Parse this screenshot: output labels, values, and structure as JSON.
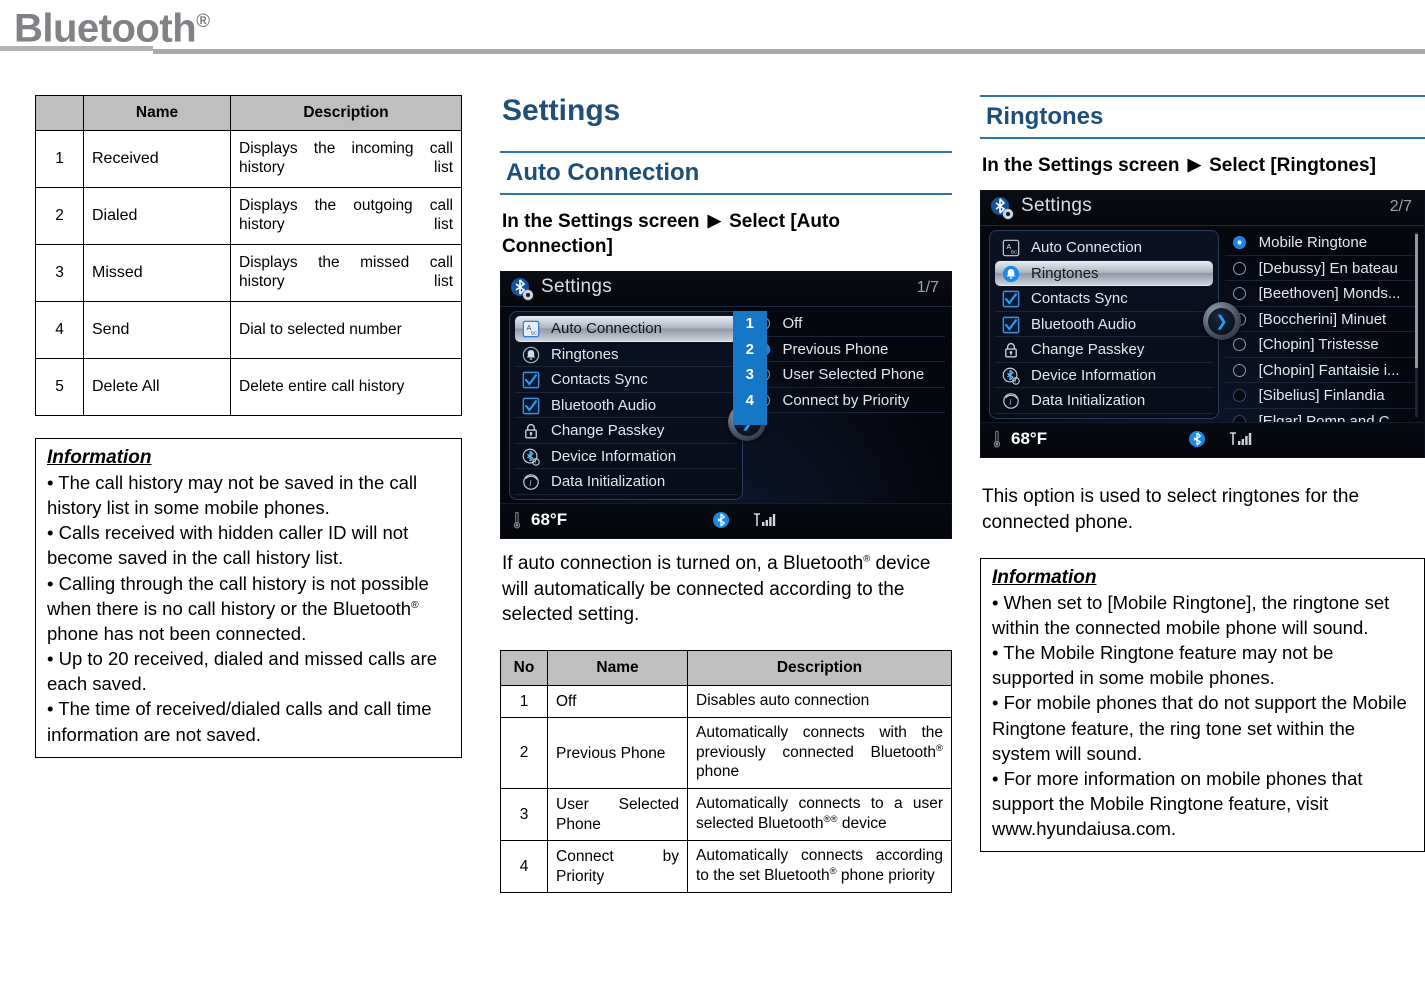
{
  "header": {
    "title": "Bluetooth",
    "registered_mark": "®"
  },
  "left_column": {
    "table": {
      "headers": [
        "",
        "Name",
        "Description"
      ],
      "rows": [
        {
          "no": "1",
          "name": "Received",
          "desc": "Displays the incoming call history list"
        },
        {
          "no": "2",
          "name": "Dialed",
          "desc": "Displays the outgoing call history list"
        },
        {
          "no": "3",
          "name": "Missed",
          "desc": "Displays the missed call history list"
        },
        {
          "no": "4",
          "name": "Send",
          "desc": "Dial to selected number"
        },
        {
          "no": "5",
          "name": "Delete All",
          "desc": "Delete entire call history"
        }
      ]
    },
    "information": {
      "title": "Information",
      "items": [
        "• The call history may not be saved in the call history list in some mobile phones.",
        "• Calls received with hidden caller ID will not become saved in the call history list.",
        "• Calling through the call history is not possible when there is no call history or the Bluetooth® phone has not been connected.",
        "• Up to 20 received, dialed and missed calls are each saved.",
        "• The time of received/dialed calls and call time information are not saved."
      ]
    }
  },
  "middle_column": {
    "chapter_title": "Settings",
    "section_title": "Auto Connection",
    "step_text_before": "In the Settings screen",
    "step_arrow": "▶",
    "step_text_after": "Select [Auto Connection]",
    "screenshot": {
      "title": "Settings",
      "page_indicator": "1/7",
      "menu_items": [
        {
          "label": "Auto Connection",
          "icon": "abc-icon",
          "selected": true,
          "checkbox": false
        },
        {
          "label": "Ringtones",
          "icon": "bell-icon",
          "selected": false,
          "checkbox": false
        },
        {
          "label": "Contacts Sync",
          "icon": "checkbox-icon",
          "selected": false,
          "checkbox": true
        },
        {
          "label": "Bluetooth Audio",
          "icon": "checkbox-icon",
          "selected": false,
          "checkbox": true
        },
        {
          "label": "Change Passkey",
          "icon": "lock-icon",
          "selected": false,
          "checkbox": false
        },
        {
          "label": "Device Information",
          "icon": "bluetooth-info-icon",
          "selected": false,
          "checkbox": false
        },
        {
          "label": "Data Initialization",
          "icon": "info-icon",
          "selected": false,
          "checkbox": false
        }
      ],
      "options": [
        {
          "label": "Off",
          "selected": false,
          "callout": "1"
        },
        {
          "label": "Previous Phone",
          "selected": true,
          "callout": "2"
        },
        {
          "label": "User Selected Phone",
          "selected": false,
          "callout": "3"
        },
        {
          "label": "Connect by Priority",
          "selected": false,
          "callout": "4"
        }
      ],
      "status_bar": {
        "temperature": "68°F"
      }
    },
    "body_text": "If auto connection is turned on, a Bluetooth® device will automatically be connected according to the selected setting.",
    "table": {
      "headers": [
        "No",
        "Name",
        "Description"
      ],
      "rows": [
        {
          "no": "1",
          "name": "Off",
          "desc": "Disables auto connection",
          "justify": false
        },
        {
          "no": "2",
          "name": "Previous Phone",
          "desc": "Automatically connects with the previously connected Bluetooth® phone",
          "justify": true
        },
        {
          "no": "3",
          "name": "User Selected Phone",
          "desc": "Automatically connects to a user selected Bluetooth®® device",
          "justify": true
        },
        {
          "no": "4",
          "name": "Connect by Priority",
          "desc": "Automatically connects according to the set Bluetooth® phone priority",
          "justify": true
        }
      ]
    }
  },
  "right_column": {
    "section_title": "Ringtones",
    "step_text_before": "In the Settings screen",
    "step_arrow": "▶",
    "step_text_after": "Select [Ringtones]",
    "screenshot": {
      "title": "Settings",
      "page_indicator": "2/7",
      "menu_items": [
        {
          "label": "Auto Connection",
          "icon": "abc-icon",
          "selected": false,
          "checkbox": false
        },
        {
          "label": "Ringtones",
          "icon": "bell-icon",
          "selected": true,
          "checkbox": false
        },
        {
          "label": "Contacts Sync",
          "icon": "checkbox-icon",
          "selected": false,
          "checkbox": true
        },
        {
          "label": "Bluetooth Audio",
          "icon": "checkbox-icon",
          "selected": false,
          "checkbox": true
        },
        {
          "label": "Change Passkey",
          "icon": "lock-icon",
          "selected": false,
          "checkbox": false
        },
        {
          "label": "Device Information",
          "icon": "bluetooth-info-icon",
          "selected": false,
          "checkbox": false
        },
        {
          "label": "Data Initialization",
          "icon": "info-icon",
          "selected": false,
          "checkbox": false
        }
      ],
      "options": [
        {
          "label": "Mobile Ringtone",
          "state": "on"
        },
        {
          "label": "[Debussy] En bateau",
          "state": "off"
        },
        {
          "label": "[Beethoven] Monds...",
          "state": "off"
        },
        {
          "label": "[Boccherini] Minuet",
          "state": "off"
        },
        {
          "label": "[Chopin] Tristesse",
          "state": "off"
        },
        {
          "label": "[Chopin] Fantaisie i...",
          "state": "off"
        },
        {
          "label": "[Sibelius] Finlandia",
          "state": "dark"
        },
        {
          "label": "[Elgar] Pomp and C...",
          "state": "dark"
        }
      ],
      "status_bar": {
        "temperature": "68°F"
      }
    },
    "body_text": "This option is used to select ringtones for the connected phone.",
    "information": {
      "title": "Information",
      "items": [
        "•  When set to [Mobile Ringtone], the ringtone set within the connected mobile phone will sound.",
        "•  The Mobile Ringtone feature may not be supported in some mobile phones.",
        "• For mobile phones that do not support the Mobile Ringtone feature, the ring tone set within the system will sound.",
        "•  For more information on mobile phones that support the Mobile Ringtone feature, visit www.hyundaiusa.com."
      ]
    }
  },
  "colors": {
    "heading_blue": "#1F4E79",
    "rule_blue": "#2E74B5",
    "header_gray": "#808285",
    "table_header_gray": "#bfbfbf",
    "hu_accent_blue": "#1577c6"
  }
}
